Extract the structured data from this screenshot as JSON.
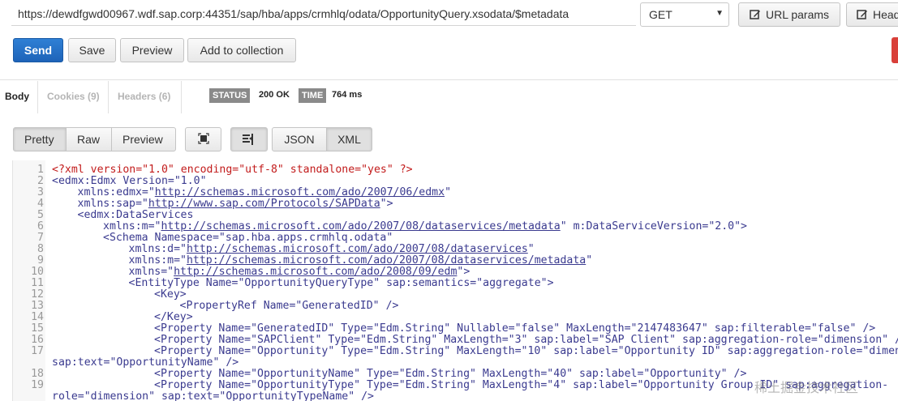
{
  "request": {
    "url": "https://dewdfgwd00967.wdf.sap.corp:44351/sap/hba/apps/crmhlq/odata/OpportunityQuery.xsodata/$metadata",
    "method": "GET",
    "url_params_label": "URL params",
    "headers_label": "Head"
  },
  "actions": {
    "send": "Send",
    "save": "Save",
    "preview": "Preview",
    "add_to_collection": "Add to collection"
  },
  "response_tabs": {
    "body": "Body",
    "cookies": "Cookies (9)",
    "headers": "Headers (6)"
  },
  "status": {
    "label": "STATUS",
    "value": "200 OK"
  },
  "time": {
    "label": "TIME",
    "value": "764 ms"
  },
  "view_modes": {
    "pretty": "Pretty",
    "raw": "Raw",
    "preview": "Preview"
  },
  "formats": {
    "json": "JSON",
    "xml": "XML",
    "selected": "XML"
  },
  "code_lines": [
    {
      "n": "1",
      "indent": 0,
      "t": "<?xml version=\"1.0\" encoding=\"utf-8\" standalone=\"yes\" ?>"
    },
    {
      "n": "2",
      "indent": 0,
      "t": "<edmx:Edmx Version=\"1.0\""
    },
    {
      "n": "3",
      "indent": 1,
      "t": "xmlns:edmx=\"http://schemas.microsoft.com/ado/2007/06/edmx\""
    },
    {
      "n": "4",
      "indent": 1,
      "t": "xmlns:sap=\"http://www.sap.com/Protocols/SAPData\">"
    },
    {
      "n": "5",
      "indent": 1,
      "t": "<edmx:DataServices"
    },
    {
      "n": "6",
      "indent": 2,
      "t": "xmlns:m=\"http://schemas.microsoft.com/ado/2007/08/dataservices/metadata\" m:DataServiceVersion=\"2.0\">"
    },
    {
      "n": "7",
      "indent": 2,
      "t": "<Schema Namespace=\"sap.hba.apps.crmhlq.odata\""
    },
    {
      "n": "8",
      "indent": 3,
      "t": "xmlns:d=\"http://schemas.microsoft.com/ado/2007/08/dataservices\""
    },
    {
      "n": "9",
      "indent": 3,
      "t": "xmlns:m=\"http://schemas.microsoft.com/ado/2007/08/dataservices/metadata\""
    },
    {
      "n": "10",
      "indent": 3,
      "t": "xmlns=\"http://schemas.microsoft.com/ado/2008/09/edm\">"
    },
    {
      "n": "11",
      "indent": 3,
      "t": "<EntityType Name=\"OpportunityQueryType\" sap:semantics=\"aggregate\">"
    },
    {
      "n": "12",
      "indent": 4,
      "t": "<Key>"
    },
    {
      "n": "13",
      "indent": 5,
      "t": "<PropertyRef Name=\"GeneratedID\" />"
    },
    {
      "n": "14",
      "indent": 4,
      "t": "</Key>"
    },
    {
      "n": "15",
      "indent": 4,
      "t": "<Property Name=\"GeneratedID\" Type=\"Edm.String\" Nullable=\"false\" MaxLength=\"2147483647\" sap:filterable=\"false\" />"
    },
    {
      "n": "16",
      "indent": 4,
      "t": "<Property Name=\"SAPClient\" Type=\"Edm.String\" MaxLength=\"3\" sap:label=\"SAP Client\" sap:aggregation-role=\"dimension\" />"
    },
    {
      "n": "17",
      "indent": 4,
      "t": "<Property Name=\"Opportunity\" Type=\"Edm.String\" MaxLength=\"10\" sap:label=\"Opportunity ID\" sap:aggregation-role=\"dimens"
    },
    {
      "n": "",
      "indent": 0,
      "t": "sap:text=\"OpportunityName\" />"
    },
    {
      "n": "18",
      "indent": 4,
      "t": "<Property Name=\"OpportunityName\" Type=\"Edm.String\" MaxLength=\"40\" sap:label=\"Opportunity\" />"
    },
    {
      "n": "19",
      "indent": 4,
      "t": "<Property Name=\"OpportunityType\" Type=\"Edm.String\" MaxLength=\"4\" sap:label=\"Opportunity Group ID\" sap:aggregation-"
    },
    {
      "n": "",
      "indent": 0,
      "t": "role=\"dimension\" sap:text=\"OpportunityTypeName\" />"
    }
  ],
  "watermark": "稀土掘金技术社区"
}
